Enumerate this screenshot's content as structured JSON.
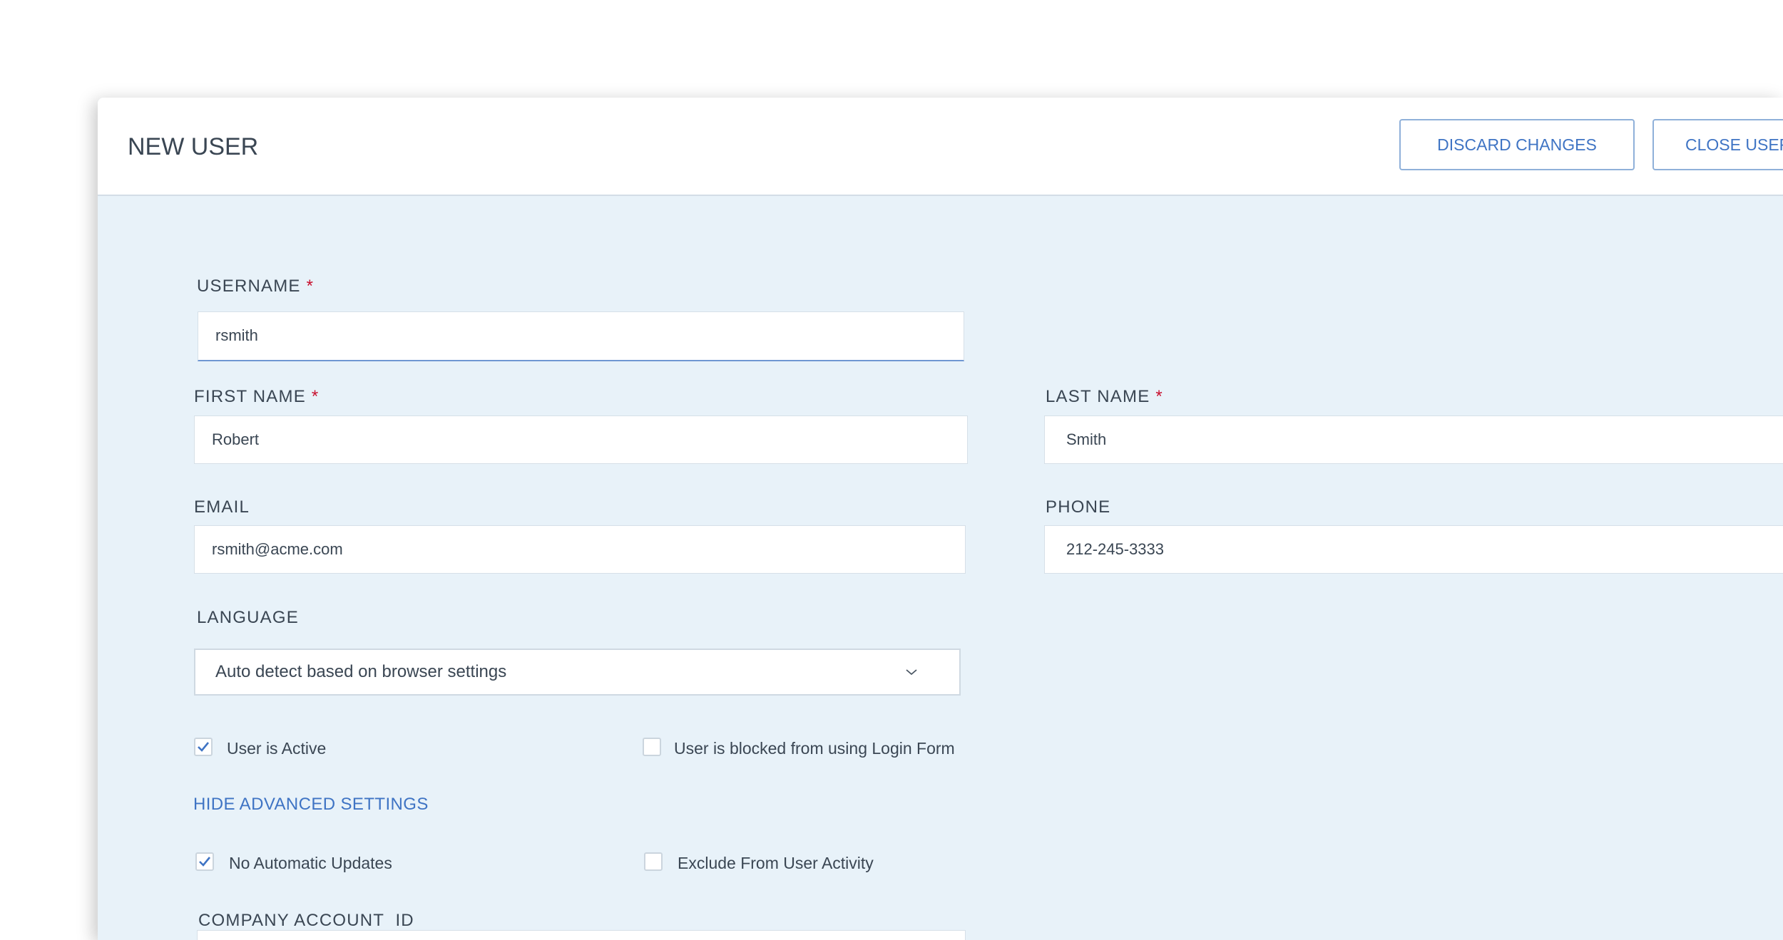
{
  "header": {
    "title": "NEW USER",
    "discard_label": "DISCARD CHANGES",
    "close_label": "CLOSE USER"
  },
  "form": {
    "required_marker": "*",
    "username": {
      "label": "USERNAME",
      "value": "rsmith"
    },
    "first_name": {
      "label": "FIRST NAME",
      "value": "Robert"
    },
    "last_name": {
      "label": "LAST NAME",
      "value": "Smith"
    },
    "email": {
      "label": "EMAIL",
      "value": "rsmith@acme.com"
    },
    "phone": {
      "label": "PHONE",
      "value": "212-245-3333"
    },
    "language": {
      "label": "LANGUAGE",
      "selected": "Auto detect based on browser settings"
    },
    "checkboxes": {
      "user_active": {
        "label": "User is Active",
        "checked": true
      },
      "blocked_login": {
        "label": "User is blocked from using Login Form",
        "checked": false
      },
      "no_auto_updates": {
        "label": "No Automatic Updates",
        "checked": true
      },
      "exclude_activity": {
        "label": "Exclude From User Activity",
        "checked": false
      }
    },
    "advanced_toggle": "HIDE ADVANCED SETTINGS",
    "company_account_id": {
      "label": "COMPANY ACCOUNT  ID",
      "value": ""
    }
  },
  "colors": {
    "accent": "#3f74c4",
    "required": "#c8102e",
    "panel_bg": "#e8f2f9",
    "check": "#3f74c4"
  },
  "icons": {
    "select_chevron": "chevron-down-icon",
    "checkmark": "checkmark-icon"
  }
}
